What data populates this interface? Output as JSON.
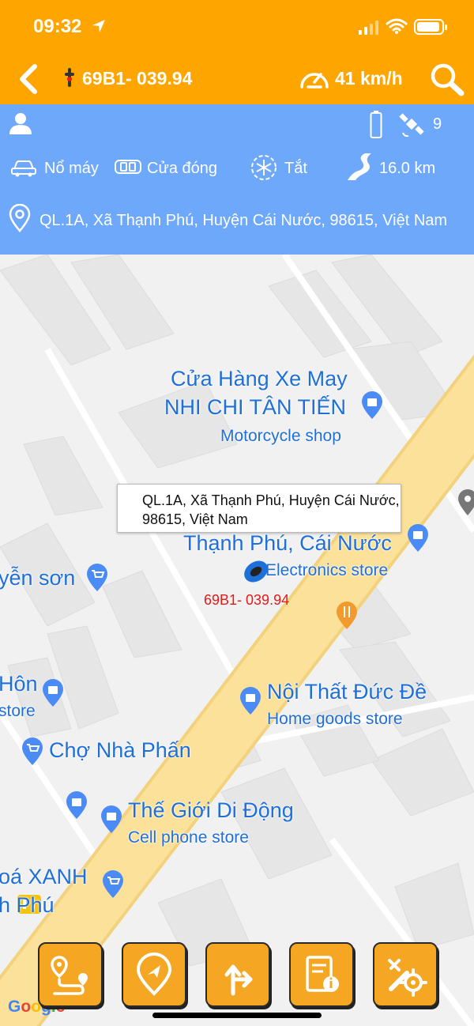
{
  "status_bar": {
    "time": "09:32"
  },
  "header": {
    "plate": "69B1- 039.94",
    "speed": "41 km/h",
    "colors": {
      "header_bg": "#FFA500",
      "panel_bg": "#6EA8FA"
    }
  },
  "info_panel": {
    "satellites": "9",
    "engine": "Nổ máy",
    "door": "Cửa đóng",
    "ac": "Tắt",
    "distance": "16.0 km",
    "address": "QL.1A, Xã Thạnh Phú, Huyện Cái Nước, 98615, Việt Nam"
  },
  "map": {
    "callout": "QL.1A, Xã Thạnh Phú, Huyện Cái Nước, 98615, Việt Nam",
    "vehicle_label": "69B1- 039.94",
    "pois": {
      "shop1_line1": "Cửa Hàng Xe May",
      "shop1_line2": "NHI CHI TÂN TIẾN",
      "shop1_type": "Motorcycle shop",
      "thanh_phu": "Thạnh Phú, Cái Nước",
      "thanh_phu_type": "Electronics store",
      "nguyen_son": "yễn sơn",
      "hon": "Hôn",
      "hon_type": "store",
      "noi_that": "Nội Thất Đức Đề",
      "noi_that_type": "Home goods store",
      "cho": "Chợ Nhà Phấn",
      "tgdd": "Thế Giới Di Động",
      "tgdd_type": "Cell phone store",
      "bhx1": "oá XANH",
      "bhx2": "h Phú"
    },
    "attribution": "Google"
  },
  "actions": [
    {
      "icon": "route-history-icon"
    },
    {
      "icon": "locate-icon"
    },
    {
      "icon": "directions-icon"
    },
    {
      "icon": "report-icon"
    },
    {
      "icon": "settings-tools-icon"
    }
  ]
}
